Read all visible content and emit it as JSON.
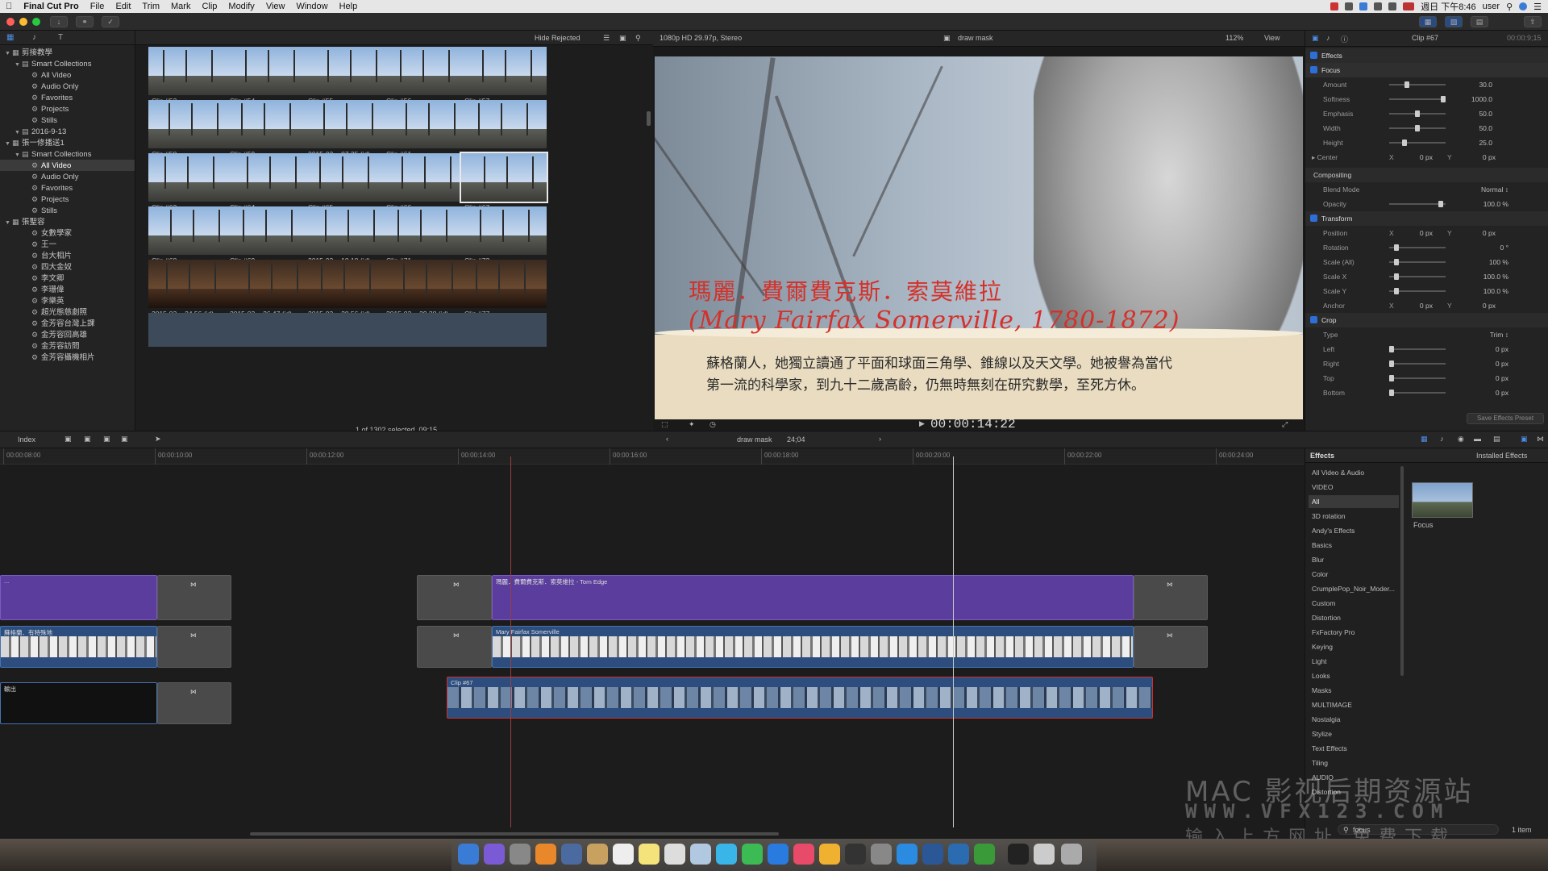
{
  "menubar": {
    "app": "Final Cut Pro",
    "items": [
      "File",
      "Edit",
      "Trim",
      "Mark",
      "Clip",
      "Modify",
      "View",
      "Window",
      "Help"
    ],
    "clock": "週日 下午8:46",
    "user": "user"
  },
  "sidebar": {
    "items": [
      {
        "label": "剪接教學",
        "level": 0
      },
      {
        "label": "Smart Collections",
        "level": 1
      },
      {
        "label": "All Video",
        "level": 2
      },
      {
        "label": "Audio Only",
        "level": 2
      },
      {
        "label": "Favorites",
        "level": 2
      },
      {
        "label": "Projects",
        "level": 2
      },
      {
        "label": "Stills",
        "level": 2
      },
      {
        "label": "2016-9-13",
        "level": 1
      },
      {
        "label": "張一修播送1",
        "level": 0
      },
      {
        "label": "Smart Collections",
        "level": 1
      },
      {
        "label": "All Video",
        "level": 2,
        "selected": true
      },
      {
        "label": "Audio Only",
        "level": 2
      },
      {
        "label": "Favorites",
        "level": 2
      },
      {
        "label": "Projects",
        "level": 2
      },
      {
        "label": "Stills",
        "level": 2
      },
      {
        "label": "張聖容",
        "level": 0
      },
      {
        "label": "女數學家",
        "level": 2
      },
      {
        "label": "王一",
        "level": 2
      },
      {
        "label": "台大相片",
        "level": 2
      },
      {
        "label": "四大金奴",
        "level": 2
      },
      {
        "label": "李文卿",
        "level": 2
      },
      {
        "label": "李珊偉",
        "level": 2
      },
      {
        "label": "李樂英",
        "level": 2
      },
      {
        "label": "超光態慈劇照",
        "level": 2
      },
      {
        "label": "金芳容台灣上課",
        "level": 2
      },
      {
        "label": "金芳容回高雄",
        "level": 2
      },
      {
        "label": "金芳容訪問",
        "level": 2
      },
      {
        "label": "金芳容攝機相片",
        "level": 2
      }
    ]
  },
  "browser": {
    "filter": "Hide Rejected",
    "status": "1 of 1302 selected, 09;15",
    "clips": [
      [
        "Clip #53",
        "Clip #54",
        "Clip #55",
        "Clip #56",
        "Clip #57"
      ],
      [
        "Clip #58",
        "Clip #59",
        "2015-03-...07,35 (id)",
        "Clip #61",
        "2015-03-...12,25 (id)"
      ],
      [
        "Clip #63",
        "Clip #64",
        "Clip #65",
        "Clip #66",
        "Clip #67"
      ],
      [
        "Clip #68",
        "Clip #69",
        "2015-03-...18,18 (id)",
        "Clip #71",
        "Clip #72"
      ],
      [
        "2015-03-...24,56 (id)",
        "2015-03-...26,47 (id)",
        "2015-03-...28,56 (id)",
        "2015-03-...29,38 (id)",
        "Clip #77"
      ]
    ]
  },
  "viewer": {
    "format": "1080p HD 29.97p, Stereo",
    "title": "draw mask",
    "zoom": "112%",
    "view_menu": "View",
    "timecode": "00:00:14:22",
    "name_cn": "瑪麗．費爾費克斯．索莫維拉",
    "name_en": "(Mary Fairfax Somerville, 1780-1872)",
    "bio_line1": "蘇格蘭人，她獨立讀通了平面和球面三角學、錐線以及天文學。她被譽為當代",
    "bio_line2": "第一流的科學家，到九十二歲高齡，仍無時無刻在研究數學，至死方休。"
  },
  "inspector": {
    "title": "Clip #67",
    "duration": "00:00:9;15",
    "effects_label": "Effects",
    "focus_label": "Focus",
    "params": [
      {
        "label": "Amount",
        "value": "30.0",
        "knob": 0.3
      },
      {
        "label": "Softness",
        "value": "1000.0",
        "knob": 1.0
      },
      {
        "label": "Emphasis",
        "value": "50.0",
        "knob": 0.5
      },
      {
        "label": "Width",
        "value": "50.0",
        "knob": 0.5
      },
      {
        "label": "Height",
        "value": "25.0",
        "knob": 0.25
      }
    ],
    "center": {
      "label": "Center",
      "x": "0",
      "y": "0",
      "unit": "px"
    },
    "compositing": "Compositing",
    "blend_mode_label": "Blend Mode",
    "blend_mode": "Normal",
    "opacity_label": "Opacity",
    "opacity": "100.0",
    "transform_label": "Transform",
    "transform": [
      {
        "label": "Position",
        "x": "0",
        "y": "0",
        "unit": "px"
      },
      {
        "label": "Rotation",
        "value": "0",
        "unit": "°"
      },
      {
        "label": "Scale (All)",
        "value": "100",
        "unit": "%"
      },
      {
        "label": "Scale X",
        "value": "100.0",
        "unit": "%"
      },
      {
        "label": "Scale Y",
        "value": "100.0",
        "unit": "%"
      },
      {
        "label": "Anchor",
        "x": "0",
        "y": "0",
        "unit": "px"
      }
    ],
    "crop_label": "Crop",
    "crop_type_label": "Type",
    "crop_type": "Trim",
    "crop": [
      {
        "label": "Left",
        "value": "0",
        "unit": "px"
      },
      {
        "label": "Right",
        "value": "0",
        "unit": "px"
      },
      {
        "label": "Top",
        "value": "0",
        "unit": "px"
      },
      {
        "label": "Bottom",
        "value": "0",
        "unit": "px"
      }
    ],
    "save_preset": "Save Effects Preset"
  },
  "timeline": {
    "index_label": "Index",
    "project": "draw mask",
    "duration": "24;04",
    "ruler": [
      "00:00:08:00",
      "00:00:10:00",
      "00:00:12:00",
      "00:00:14:00",
      "00:00:16:00",
      "00:00:18:00",
      "00:00:20:00",
      "00:00:22:00",
      "00:00:24:00"
    ],
    "title_clip": "瑪麗．費爾費克斯．索莫維拉 - Torn Edge",
    "portrait_clip": "Mary Fairfax Somerville",
    "left_clip": "蘇格蘭．有特殊地",
    "left_clip2": "輸出",
    "video_clip": "Clip #67"
  },
  "effects": {
    "title": "Effects",
    "installed": "Installed Effects",
    "categories": [
      "All Video & Audio",
      "VIDEO",
      "All",
      "3D rotation",
      "Andy's Effects",
      "Basics",
      "Blur",
      "Color",
      "CrumplePop_Noir_Moder...",
      "Custom",
      "Distortion",
      "FxFactory Pro",
      "Keying",
      "Light",
      "Looks",
      "Masks",
      "MULTIMAGE",
      "Nostalgia",
      "Stylize",
      "Text Effects",
      "Tiling",
      "AUDIO",
      "Distortion"
    ],
    "selected_index": 2,
    "result_name": "Focus",
    "search": "focus",
    "count": "1 item"
  },
  "watermark": {
    "line1": "MAC 影视后期资源站",
    "line2": "WWW.VFX123.COM",
    "line3": "输入上方网址 免费下载"
  },
  "colors": {
    "accent": "#2d6fd6",
    "title_clip": "#5a3d9c",
    "video_clip": "#2c4d7d",
    "name_red": "#d4312a"
  }
}
